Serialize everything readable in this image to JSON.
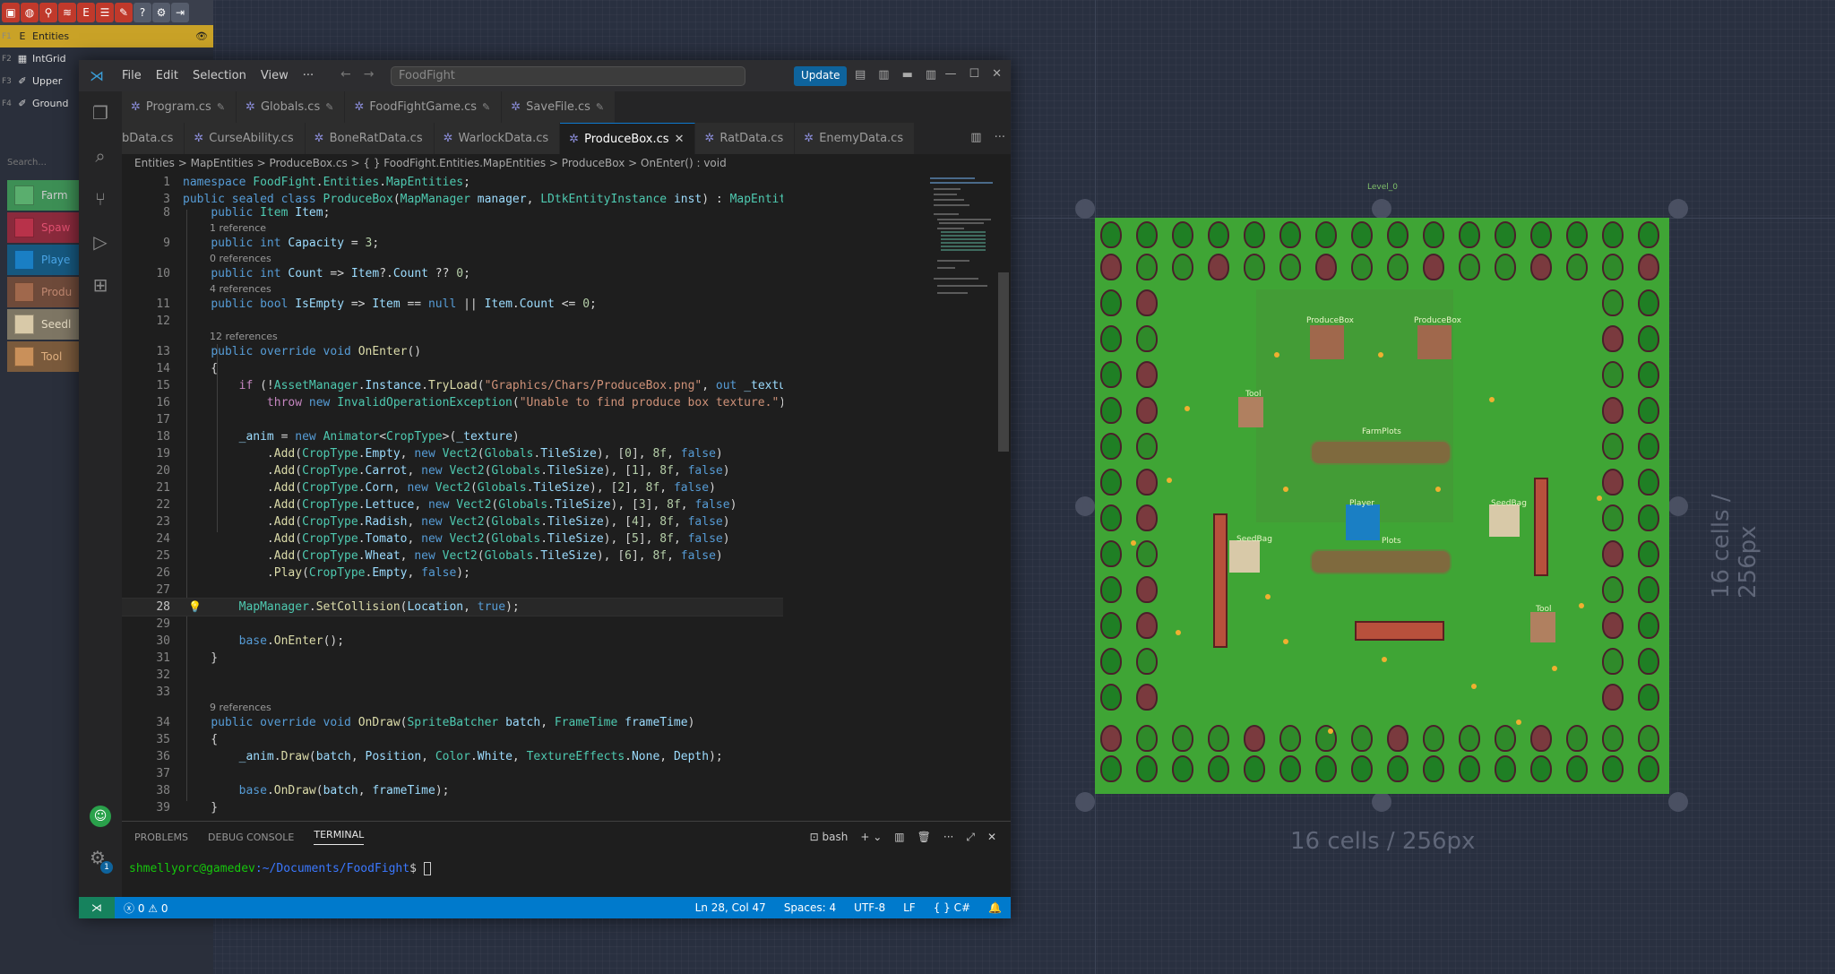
{
  "ldtk": {
    "layers": [
      {
        "key": "F1",
        "name": "Entities",
        "selected": true
      },
      {
        "key": "F2",
        "name": "IntGrid",
        "selected": false
      },
      {
        "key": "F3",
        "name": "Upper",
        "selected": false
      },
      {
        "key": "F4",
        "name": "Ground",
        "selected": false
      }
    ],
    "search_placeholder": "Search...",
    "entities": [
      {
        "name": "Farm",
        "color": "#3d8f55"
      },
      {
        "name": "Spaw",
        "color": "#b8324a"
      },
      {
        "name": "Playe",
        "color": "#1a7fc4"
      },
      {
        "name": "Produ",
        "color": "#a0684c"
      },
      {
        "name": "Seedl",
        "color": "#d8c9a8"
      },
      {
        "name": "Tool",
        "color": "#c9905a"
      }
    ],
    "level_name": "Level_0",
    "dim_label": "16 cells / 256px",
    "map_labels": {
      "produce_box_1": "ProduceBox",
      "produce_box_2": "ProduceBox",
      "tool_1": "Tool",
      "tool_2": "Tool",
      "farm_plots_1": "FarmPlots",
      "farm_plots_2": "Plots",
      "player": "Player",
      "seed_bag_1": "SeedBag",
      "seed_bag_2": "SeedBag"
    }
  },
  "vscode": {
    "menu": [
      "File",
      "Edit",
      "Selection",
      "View",
      "···"
    ],
    "command_center": "FoodFight",
    "update_label": "Update",
    "tabs_row1": [
      "Program.cs",
      "Globals.cs",
      "FoodFightGame.cs",
      "SaveFile.cs"
    ],
    "tabs_row2": [
      "bData.cs",
      "CurseAbility.cs",
      "BoneRatData.cs",
      "WarlockData.cs",
      "ProduceBox.cs",
      "RatData.cs",
      "EnemyData.cs"
    ],
    "active_tab": "ProduceBox.cs",
    "breadcrumb": "Entities  >  MapEntities  >  ProduceBox.cs  >  { } FoodFight.Entities.MapEntities  >  ProduceBox  >  OnEnter() : void",
    "lenses": {
      "l9": "1 reference",
      "l10": "0 references",
      "l11": "4 references",
      "l13": "12 references",
      "l34": "9 references"
    },
    "panel_tabs": [
      "PROBLEMS",
      "DEBUG CONSOLE",
      "TERMINAL"
    ],
    "panel_shell": "bash",
    "terminal_user": "shmellyorc@gamedev",
    "terminal_path": ":~/Documents/FoodFight",
    "terminal_prompt": "$ ",
    "status": {
      "errors": "0",
      "warnings": "0",
      "position": "Ln 28, Col 47",
      "spaces": "Spaces: 4",
      "encoding": "UTF-8",
      "eol": "LF",
      "language": "C#"
    },
    "settings_badge": "1"
  }
}
